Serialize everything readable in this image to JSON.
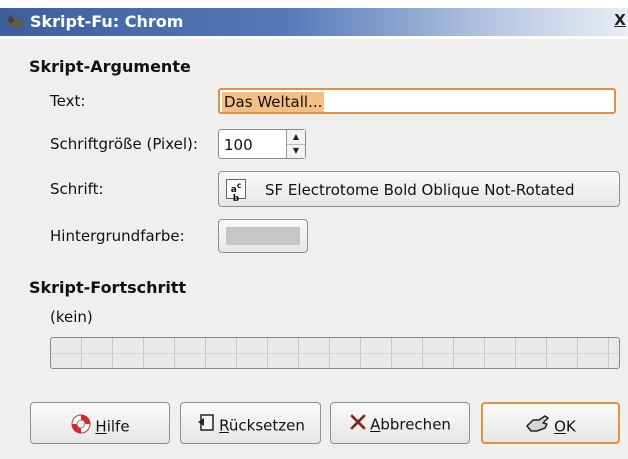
{
  "window": {
    "title": "Skript-Fu: Chrom",
    "close_label": "X"
  },
  "arguments": {
    "section_title": "Skript-Argumente",
    "text_label": "Text:",
    "text_value": "Das Weltall...",
    "fontsize_label": "Schriftgröße (Pixel):",
    "fontsize_value": "100",
    "font_label": "Schrift:",
    "font_value": "SF Electrotome Bold Oblique Not-Rotated",
    "bgcolor_label": "Hintergrundfarbe:",
    "bgcolor_value": "#c6c6c6"
  },
  "progress": {
    "section_title": "Skript-Fortschritt",
    "status": "(kein)",
    "fraction": 0
  },
  "buttons": {
    "help_accel": "H",
    "help_rest": "ilfe",
    "reset_accel": "R",
    "reset_rest": "ücksetzen",
    "cancel_accel": "A",
    "cancel_rest": "bbrechen",
    "ok_accel": "O",
    "ok_rest": "K"
  },
  "icons": {
    "window": "gimp-wilber-icon",
    "font": "font-icon",
    "help": "lifebuoy-icon",
    "reset": "reset-icon",
    "cancel": "x-icon",
    "ok": "ok-hand-icon"
  },
  "colors": {
    "title_bar": "#3e5f9c",
    "focus": "#e3913f",
    "selection": "#f4bf85"
  }
}
